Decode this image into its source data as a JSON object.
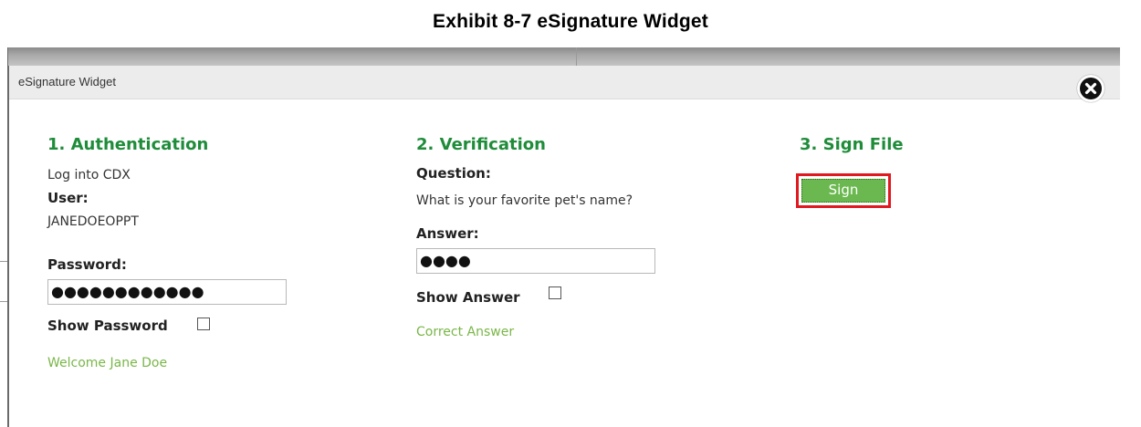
{
  "caption": "Exhibit 8-7 eSignature Widget",
  "widget": {
    "title": "eSignature Widget"
  },
  "authentication": {
    "heading": "1. Authentication",
    "instruction": "Log into CDX",
    "user_label": "User:",
    "user_value": "JANEDOEOPPT",
    "password_label": "Password:",
    "password_value": "●●●●●●●●●●●●",
    "show_password_label": "Show Password",
    "show_password_checked": false,
    "status": "Welcome Jane Doe"
  },
  "verification": {
    "heading": "2. Verification",
    "question_label": "Question:",
    "question_text": "What is your favorite pet's name?",
    "answer_label": "Answer:",
    "answer_value": "●●●●",
    "show_answer_label": "Show Answer",
    "show_answer_checked": false,
    "status": "Correct Answer"
  },
  "sign": {
    "heading": "3. Sign File",
    "button_label": "Sign"
  },
  "colors": {
    "section_heading": "#1f8c3a",
    "status_text": "#7ab648",
    "sign_button": "#6ab84f",
    "highlight_border": "#e0191f"
  },
  "icons": {
    "close": "close-icon"
  }
}
